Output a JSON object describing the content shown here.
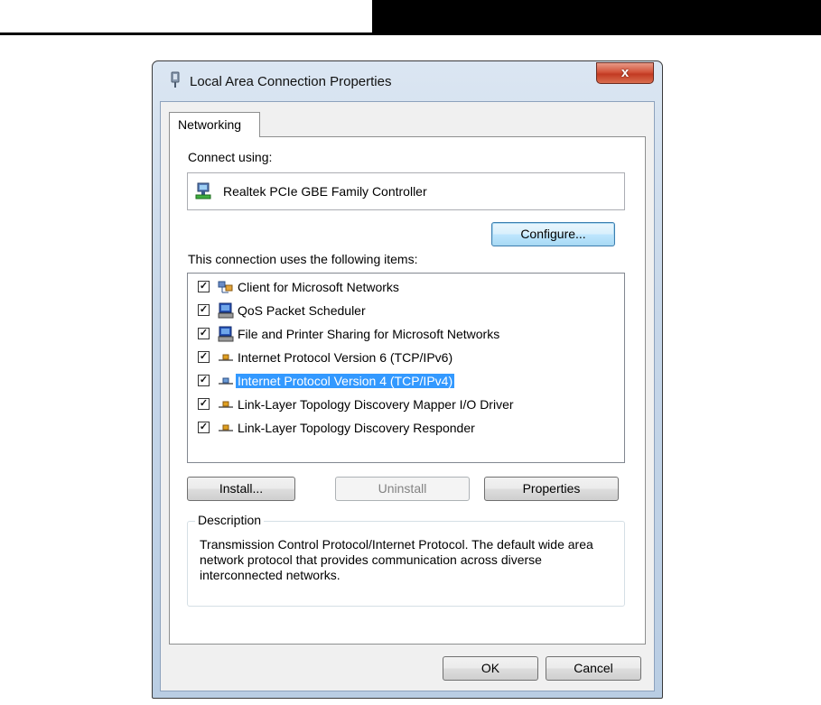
{
  "window": {
    "title": "Local Area Connection Properties",
    "close_glyph": "x"
  },
  "tabs": [
    {
      "label": "Networking",
      "selected": true
    }
  ],
  "connect_using": {
    "label": "Connect using:",
    "adapter_name": "Realtek PCIe GBE Family Controller",
    "adapter_icon": "network-adapter-icon"
  },
  "configure_button": {
    "label": "Configure..."
  },
  "items_section": {
    "label": "This connection uses the following items:",
    "items": [
      {
        "label": "Client for Microsoft Networks",
        "checked": true,
        "icon": "network-client-icon",
        "selected": false
      },
      {
        "label": "QoS Packet Scheduler",
        "checked": true,
        "icon": "network-service-icon",
        "selected": false
      },
      {
        "label": "File and Printer Sharing for Microsoft Networks",
        "checked": true,
        "icon": "network-service-icon",
        "selected": false
      },
      {
        "label": "Internet Protocol Version 6 (TCP/IPv6)",
        "checked": true,
        "icon": "network-protocol-icon",
        "selected": false
      },
      {
        "label": "Internet Protocol Version 4 (TCP/IPv4)",
        "checked": true,
        "icon": "network-protocol-icon",
        "selected": true
      },
      {
        "label": "Link-Layer Topology Discovery Mapper I/O Driver",
        "checked": true,
        "icon": "network-protocol-icon",
        "selected": false
      },
      {
        "label": "Link-Layer Topology Discovery Responder",
        "checked": true,
        "icon": "network-protocol-icon",
        "selected": false
      }
    ]
  },
  "buttons": {
    "install": "Install...",
    "uninstall": "Uninstall",
    "properties": "Properties",
    "ok": "OK",
    "cancel": "Cancel"
  },
  "description": {
    "legend": "Description",
    "text": "Transmission Control Protocol/Internet Protocol. The default wide area network protocol that provides communication across diverse interconnected networks."
  },
  "colors": {
    "selection": "#3399ff",
    "close_button": "#c9452d",
    "window_frame": "#c7d7e9"
  }
}
